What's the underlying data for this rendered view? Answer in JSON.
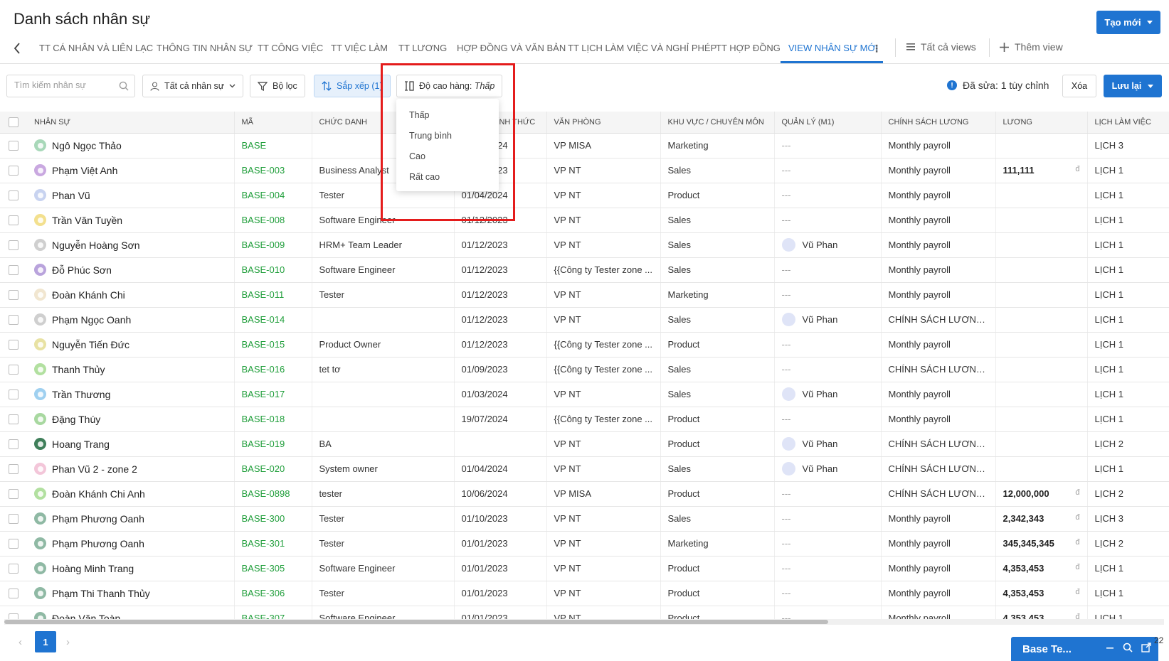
{
  "header": {
    "title": "Danh sách nhân sự",
    "create_label": "Tạo mới"
  },
  "tabs": [
    {
      "label": "TT CÁ NHÂN VÀ LIÊN LẠC"
    },
    {
      "label": "THÔNG TIN NHÂN SỰ"
    },
    {
      "label": "TT CÔNG VIỆC"
    },
    {
      "label": "TT VIỆC LÀM"
    },
    {
      "label": "TT LƯƠNG"
    },
    {
      "label": "HỢP ĐỒNG VÀ VĂN BẢN"
    },
    {
      "label": "TT LỊCH LÀM VIỆC VÀ NGHỈ PHÉP"
    },
    {
      "label": "TT HỢP ĐỒNG"
    },
    {
      "label": "VIEW NHÂN SỰ MỚI",
      "active": true
    }
  ],
  "views": {
    "all_views": "Tất cả views",
    "add_view": "Thêm view"
  },
  "toolbar": {
    "search_placeholder": "Tìm kiếm nhân sự",
    "all_staff": "Tất cả nhân sự",
    "filter": "Bộ lọc",
    "sort": "Sắp xếp (1)",
    "row_height_prefix": "Độ cao hàng:",
    "row_height_value": "Thấp",
    "edited_note": "Đã sửa: 1 tùy chỉnh",
    "clear": "Xóa",
    "save": "Lưu lại"
  },
  "row_height_menu": [
    "Thấp",
    "Trung bình",
    "Cao",
    "Rất cao"
  ],
  "columns": [
    "NHÂN SỰ",
    "MÃ",
    "CHỨC DANH",
    "NGÀY CHÍNH THỨC",
    "VĂN PHÒNG",
    "KHU VỰC / CHUYÊN MÔN",
    "QUẢN LÝ (M1)",
    "CHÍNH SÁCH LƯƠNG",
    "LƯƠNG",
    "LỊCH LÀM VIỆC"
  ],
  "rows": [
    {
      "name": "Ngô Ngọc Thảo",
      "avatar": "#a8d8b9",
      "code": "BASE",
      "title": "",
      "date": "01/04/2024",
      "office": "VP MISA",
      "area": "Marketing",
      "manager": "---",
      "policy": "Monthly payroll",
      "salary": "",
      "schedule": "LỊCH 3"
    },
    {
      "name": "Phạm Việt Anh",
      "avatar": "#c9a8e0",
      "code": "BASE-003",
      "title": "Business Analyst",
      "date": "01/04/2023",
      "office": "VP NT",
      "area": "Sales",
      "manager": "---",
      "policy": "Monthly payroll",
      "salary": "111,111",
      "schedule": "LỊCH 1"
    },
    {
      "name": "Phan Vũ",
      "avatar": "#c8d3f0",
      "code": "BASE-004",
      "title": "Tester",
      "date": "01/04/2024",
      "office": "VP NT",
      "area": "Product",
      "manager": "---",
      "policy": "Monthly payroll",
      "salary": "",
      "schedule": "LỊCH 1"
    },
    {
      "name": "Trần Văn Tuyền",
      "avatar": "#f3e08e",
      "code": "BASE-008",
      "title": "Software Engineer",
      "date": "01/12/2023",
      "office": "VP NT",
      "area": "Sales",
      "manager": "---",
      "policy": "Monthly payroll",
      "salary": "",
      "schedule": "LỊCH 1"
    },
    {
      "name": "Nguyễn Hoàng Sơn",
      "avatar": "#cfcfcf",
      "code": "BASE-009",
      "title": "HRM+ Team Leader",
      "date": "01/12/2023",
      "office": "VP NT",
      "area": "Sales",
      "manager": "Vũ Phan",
      "policy": "Monthly payroll",
      "salary": "",
      "schedule": "LỊCH 1"
    },
    {
      "name": "Đỗ Phúc Sơn",
      "avatar": "#b9a3dc",
      "code": "BASE-010",
      "title": "Software Engineer",
      "date": "01/12/2023",
      "office": "{{Công ty Tester zone ...",
      "area": "Sales",
      "manager": "---",
      "policy": "Monthly payroll",
      "salary": "",
      "schedule": "LỊCH 1"
    },
    {
      "name": "Đoàn Khánh Chi",
      "avatar": "#f1e6d0",
      "code": "BASE-011",
      "title": "Tester",
      "date": "01/12/2023",
      "office": "VP NT",
      "area": "Marketing",
      "manager": "---",
      "policy": "Monthly payroll",
      "salary": "",
      "schedule": "LỊCH 1"
    },
    {
      "name": "Phạm Ngọc Oanh",
      "avatar": "#cfcfcf",
      "code": "BASE-014",
      "title": "",
      "date": "01/12/2023",
      "office": "VP NT",
      "area": "Sales",
      "manager": "Vũ Phan",
      "policy": "CHÍNH SÁCH LƯƠNG 2",
      "salary": "",
      "schedule": "LỊCH 1"
    },
    {
      "name": "Nguyễn Tiến Đức",
      "avatar": "#e8e2a3",
      "code": "BASE-015",
      "title": "Product Owner",
      "date": "01/12/2023",
      "office": "{{Công ty Tester zone ...",
      "area": "Product",
      "manager": "---",
      "policy": "Monthly payroll",
      "salary": "",
      "schedule": "LỊCH 1"
    },
    {
      "name": "Thanh Thủy",
      "avatar": "#b2e0a0",
      "code": "BASE-016",
      "title": "tet tơ",
      "date": "01/09/2023",
      "office": "{{Công ty Tester zone ...",
      "area": "Sales",
      "manager": "---",
      "policy": "CHÍNH SÁCH LƯƠNG 2",
      "salary": "",
      "schedule": "LỊCH 1"
    },
    {
      "name": "Trần Thương",
      "avatar": "#9fd0f0",
      "code": "BASE-017",
      "title": "",
      "date": "01/03/2024",
      "office": "VP NT",
      "area": "Sales",
      "manager": "Vũ Phan",
      "policy": "Monthly payroll",
      "salary": "",
      "schedule": "LỊCH 1"
    },
    {
      "name": "Đặng Thúy",
      "avatar": "#a8d8a0",
      "code": "BASE-018",
      "title": "",
      "date": "19/07/2024",
      "office": "{{Công ty Tester zone ...",
      "area": "Product",
      "manager": "---",
      "policy": "Monthly payroll",
      "salary": "",
      "schedule": "LỊCH 1"
    },
    {
      "name": "Hoang Trang",
      "avatar": "#3f7f5a",
      "code": "BASE-019",
      "title": "BA",
      "date": "",
      "office": "VP NT",
      "area": "Product",
      "manager": "Vũ Phan",
      "policy": "CHÍNH SÁCH LƯƠNG 2",
      "salary": "",
      "schedule": "LỊCH 2"
    },
    {
      "name": "Phan Vũ 2 - zone 2",
      "avatar": "#f3c6d9",
      "code": "BASE-020",
      "title": "System owner",
      "date": "01/04/2024",
      "office": "VP NT",
      "area": "Sales",
      "manager": "Vũ Phan",
      "policy": "CHÍNH SÁCH LƯƠNG 2",
      "salary": "",
      "schedule": "LỊCH 1"
    },
    {
      "name": "Đoàn Khánh Chi Anh",
      "avatar": "#b2e0a0",
      "code": "BASE-0898",
      "title": "tester",
      "date": "10/06/2024",
      "office": "VP MISA",
      "area": "Product",
      "manager": "---",
      "policy": "CHÍNH SÁCH LƯƠNG 2",
      "salary": "12,000,000",
      "schedule": "LỊCH 2"
    },
    {
      "name": "Phạm Phương Oanh",
      "avatar": "#8fb9a4",
      "code": "BASE-300",
      "title": "Tester",
      "date": "01/10/2023",
      "office": "VP NT",
      "area": "Sales",
      "manager": "---",
      "policy": "Monthly payroll",
      "salary": "2,342,343",
      "schedule": "LỊCH 3"
    },
    {
      "name": "Phạm Phương Oanh",
      "avatar": "#8fb9a4",
      "code": "BASE-301",
      "title": "Tester",
      "date": "01/01/2023",
      "office": "VP NT",
      "area": "Marketing",
      "manager": "---",
      "policy": "Monthly payroll",
      "salary": "345,345,345",
      "schedule": "LỊCH 2"
    },
    {
      "name": "Hoàng Minh Trang",
      "avatar": "#8fb9a4",
      "code": "BASE-305",
      "title": "Software Engineer",
      "date": "01/01/2023",
      "office": "VP NT",
      "area": "Product",
      "manager": "---",
      "policy": "Monthly payroll",
      "salary": "4,353,453",
      "schedule": "LỊCH 1"
    },
    {
      "name": "Phạm Thi Thanh Thủy",
      "avatar": "#8fb9a4",
      "code": "BASE-306",
      "title": "Tester",
      "date": "01/01/2023",
      "office": "VP NT",
      "area": "Product",
      "manager": "---",
      "policy": "Monthly payroll",
      "salary": "4,353,453",
      "schedule": "LỊCH 1"
    },
    {
      "name": "Đoàn Văn Toàn",
      "avatar": "#8fb9a4",
      "code": "BASE-307",
      "title": "Software Engineer",
      "date": "01/01/2023",
      "office": "VP NT",
      "area": "Product",
      "manager": "---",
      "policy": "Monthly payroll",
      "salary": "4,353,453",
      "schedule": "LỊCH 1"
    }
  ],
  "currency_symbol": "đ",
  "pagination": {
    "current_page": "1"
  },
  "chat_widget": {
    "label": "Base Te..."
  },
  "corner_text": "22",
  "colors": {
    "accent": "#1f74d1",
    "code_green": "#1f9e3a",
    "highlight_red": "#e41c1c"
  }
}
